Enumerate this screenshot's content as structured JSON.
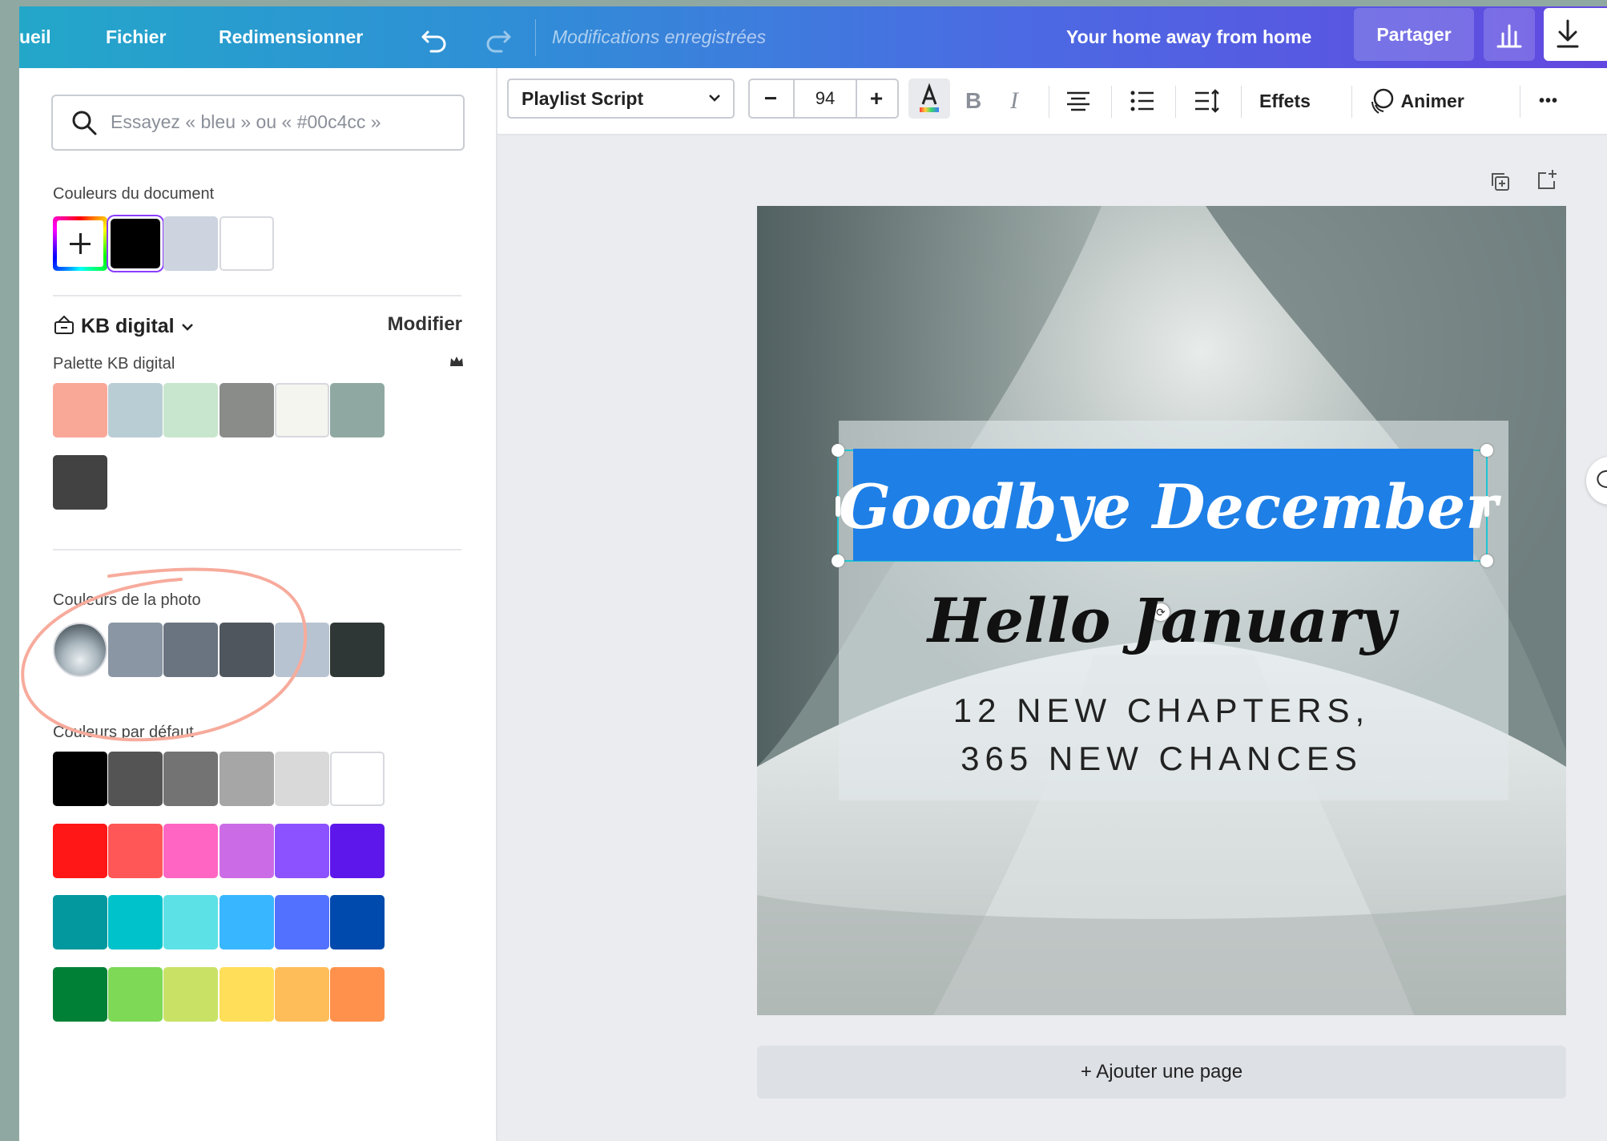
{
  "topbar": {
    "home_label": "ueil",
    "file_label": "Fichier",
    "resize_label": "Redimensionner",
    "status": "Modifications enregistrées",
    "design_title": "Your home away from home",
    "share_label": "Partager"
  },
  "panel": {
    "search_placeholder": "Essayez « bleu » ou « #00c4cc »",
    "doc_colors_label": "Couleurs du document",
    "doc_colors": [
      "#000000",
      "#cdd4df",
      "#ffffff"
    ],
    "brand_name": "KB digital",
    "brand_edit": "Modifier",
    "palette_label": "Palette KB digital",
    "palette_colors": [
      "#f9a898",
      "#b9cdd4",
      "#c8e6cd",
      "#8a8c8a",
      "#f4f5ef",
      "#8fa9a2",
      "#424242"
    ],
    "photo_colors_label": "Couleurs de la photo",
    "photo_colors": [
      "#8a96a3",
      "#6a7480",
      "#4f565e",
      "#b7c3d1",
      "#2f3736"
    ],
    "default_colors_label": "Couleurs par défaut",
    "default_colors": [
      [
        "#000000",
        "#545454",
        "#737373",
        "#a6a6a6",
        "#d9d9d9",
        "#ffffff"
      ],
      [
        "#ff1616",
        "#ff5757",
        "#ff66c4",
        "#cb6ce6",
        "#8c52ff",
        "#5e17eb"
      ],
      [
        "#03989e",
        "#00c2cb",
        "#5ce1e6",
        "#38b6ff",
        "#5271ff",
        "#004aad"
      ],
      [
        "#008037",
        "#7ed957",
        "#c9e265",
        "#ffde59",
        "#ffbd59",
        "#ff914d"
      ]
    ]
  },
  "toolbar": {
    "font_name": "Playlist Script",
    "font_size": "94",
    "decrease_label": "−",
    "increase_label": "+",
    "bold_label": "B",
    "italic_label": "I",
    "effects_label": "Effets",
    "animate_label": "Animer",
    "more_label": "•••"
  },
  "canvas": {
    "headline": "Goodbye December",
    "subhead": "Hello January",
    "line1": "12 NEW CHAPTERS,",
    "line2": "365 NEW CHANCES",
    "add_page_label": "+ Ajouter une page"
  }
}
